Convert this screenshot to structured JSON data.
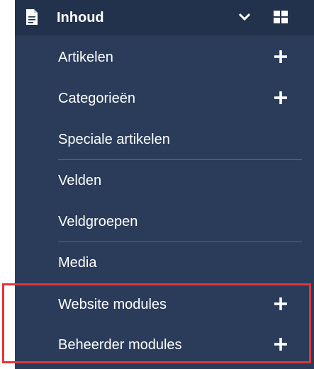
{
  "header": {
    "title": "Inhoud",
    "icon": "document-icon",
    "toggle_icon": "chevron-down-icon",
    "dashboard_icon": "grid-icon"
  },
  "menu": {
    "items": [
      {
        "label": "Artikelen",
        "has_add": true
      },
      {
        "label": "Categorieën",
        "has_add": true
      },
      {
        "label": "Speciale artikelen",
        "has_add": false
      },
      {
        "label": "Velden",
        "has_add": false
      },
      {
        "label": "Veldgroepen",
        "has_add": false
      },
      {
        "label": "Media",
        "has_add": false
      },
      {
        "label": "Website modules",
        "has_add": true
      },
      {
        "label": "Beheerder modules",
        "has_add": true
      }
    ]
  },
  "colors": {
    "panel": "#2a3c5a",
    "header": "#23324c",
    "divider": "#4e6a94",
    "highlight": "#e0363c",
    "text": "#ffffff"
  }
}
